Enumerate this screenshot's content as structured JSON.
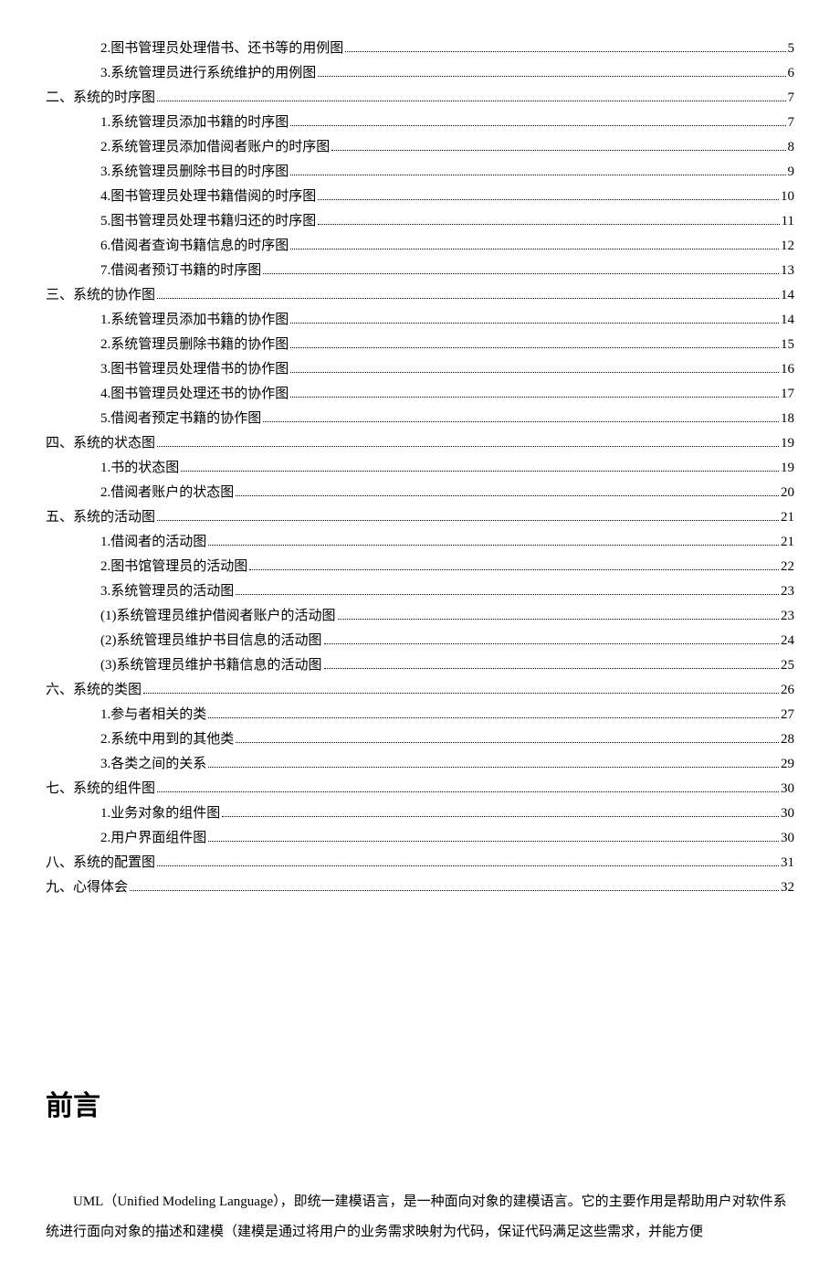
{
  "toc": [
    {
      "level": 2,
      "label": "2.图书管理员处理借书、还书等的用例图",
      "page": "5"
    },
    {
      "level": 2,
      "label": "3.系统管理员进行系统维护的用例图",
      "page": "6"
    },
    {
      "level": 1,
      "label": "二、系统的时序图",
      "page": "7"
    },
    {
      "level": 2,
      "label": "1.系统管理员添加书籍的时序图",
      "page": "7"
    },
    {
      "level": 2,
      "label": "2.系统管理员添加借阅者账户的时序图",
      "page": "8"
    },
    {
      "level": 2,
      "label": "3.系统管理员删除书目的时序图",
      "page": "9"
    },
    {
      "level": 2,
      "label": "4.图书管理员处理书籍借阅的时序图",
      "page": "10"
    },
    {
      "level": 2,
      "label": "5.图书管理员处理书籍归还的时序图",
      "page": "11"
    },
    {
      "level": 2,
      "label": "6.借阅者查询书籍信息的时序图",
      "page": "12"
    },
    {
      "level": 2,
      "label": "7.借阅者预订书籍的时序图",
      "page": "13"
    },
    {
      "level": 1,
      "label": "三、系统的协作图",
      "page": "14"
    },
    {
      "level": 2,
      "label": "1.系统管理员添加书籍的协作图",
      "page": "14"
    },
    {
      "level": 2,
      "label": "2.系统管理员删除书籍的协作图",
      "page": "15"
    },
    {
      "level": 2,
      "label": "3.图书管理员处理借书的协作图",
      "page": "16"
    },
    {
      "level": 2,
      "label": "4.图书管理员处理还书的协作图",
      "page": "17"
    },
    {
      "level": 2,
      "label": "5.借阅者预定书籍的协作图",
      "page": "18"
    },
    {
      "level": 1,
      "label": "四、系统的状态图",
      "page": "19"
    },
    {
      "level": 2,
      "label": "1.书的状态图",
      "page": "19"
    },
    {
      "level": 2,
      "label": "2.借阅者账户的状态图",
      "page": "20"
    },
    {
      "level": 1,
      "label": "五、系统的活动图",
      "page": "21"
    },
    {
      "level": 2,
      "label": "1.借阅者的活动图",
      "page": "21"
    },
    {
      "level": 2,
      "label": "2.图书馆管理员的活动图",
      "page": "22"
    },
    {
      "level": 2,
      "label": "3.系统管理员的活动图",
      "page": "23"
    },
    {
      "level": 3,
      "label": "(1)系统管理员维护借阅者账户的活动图",
      "page": "23"
    },
    {
      "level": 3,
      "label": "(2)系统管理员维护书目信息的活动图",
      "page": "24"
    },
    {
      "level": 3,
      "label": "(3)系统管理员维护书籍信息的活动图",
      "page": "25"
    },
    {
      "level": 1,
      "label": "六、系统的类图",
      "page": "26"
    },
    {
      "level": 2,
      "label": "1.参与者相关的类",
      "page": "27"
    },
    {
      "level": 2,
      "label": "2.系统中用到的其他类",
      "page": "28"
    },
    {
      "level": 2,
      "label": "3.各类之间的关系",
      "page": "29"
    },
    {
      "level": 1,
      "label": "七、系统的组件图",
      "page": "30"
    },
    {
      "level": 2,
      "label": "1.业务对象的组件图",
      "page": "30"
    },
    {
      "level": 2,
      "label": "2.用户界面组件图",
      "page": "30"
    },
    {
      "level": 1,
      "label": "八、系统的配置图",
      "page": "31"
    },
    {
      "level": 1,
      "label": "九、心得体会",
      "page": "32"
    }
  ],
  "heading": "前言",
  "paragraph": "UML（Unified Modeling Language），即统一建模语言，是一种面向对象的建模语言。它的主要作用是帮助用户对软件系统进行面向对象的描述和建模（建模是通过将用户的业务需求映射为代码，保证代码满足这些需求，并能方便"
}
